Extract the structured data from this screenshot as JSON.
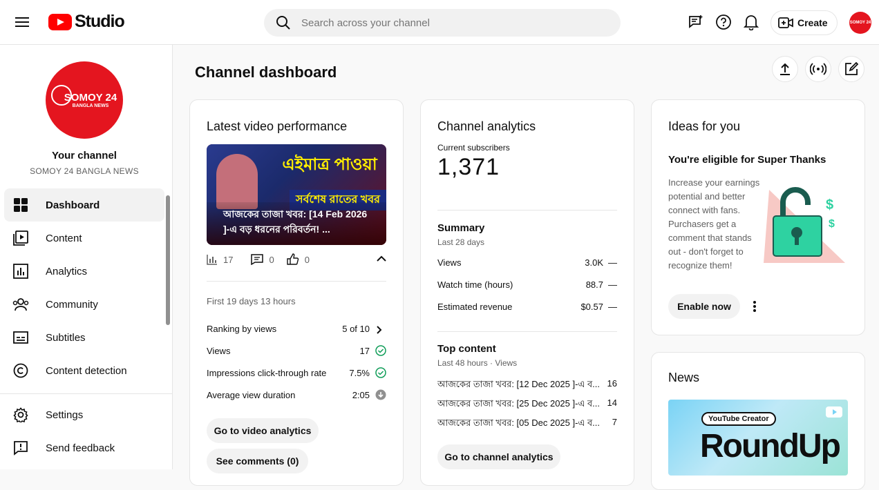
{
  "header": {
    "logo_text": "Studio",
    "search_placeholder": "Search across your channel",
    "create_label": "Create",
    "avatar_text": "SOMOY 24"
  },
  "sidebar": {
    "your_channel": "Your channel",
    "channel_name": "SOMOY 24 BANGLA NEWS",
    "avatar_line1": "SOMOY 24",
    "avatar_line2": "BANGLA NEWS",
    "items": [
      {
        "label": "Dashboard",
        "icon": "dashboard-icon",
        "active": true
      },
      {
        "label": "Content",
        "icon": "content-icon"
      },
      {
        "label": "Analytics",
        "icon": "analytics-icon"
      },
      {
        "label": "Community",
        "icon": "community-icon"
      },
      {
        "label": "Subtitles",
        "icon": "subtitles-icon"
      },
      {
        "label": "Content detection",
        "icon": "copyright-icon"
      }
    ],
    "bottom_items": [
      {
        "label": "Settings",
        "icon": "gear-icon"
      },
      {
        "label": "Send feedback",
        "icon": "feedback-icon"
      }
    ]
  },
  "main": {
    "title": "Channel dashboard"
  },
  "latest_video": {
    "title": "Latest video performance",
    "thumb_banner": "এইমাত্র পাওয়া",
    "thumb_banner2": "সর্বশেষ রাতের খবর",
    "caption": "আজকের তাজা খবর: [14 Feb 2026 ]-এ বড় ধরনের পরিবর্তন! ...",
    "views_count": "17",
    "comments_count": "0",
    "likes_count": "0",
    "period": "First 19 days 13 hours",
    "rows": [
      {
        "label": "Ranking by views",
        "value": "5 of 10"
      },
      {
        "label": "Views",
        "value": "17"
      },
      {
        "label": "Impressions click-through rate",
        "value": "7.5%"
      },
      {
        "label": "Average view duration",
        "value": "2:05"
      }
    ],
    "btn_analytics": "Go to video analytics",
    "btn_comments": "See comments (0)"
  },
  "channel_analytics": {
    "title": "Channel analytics",
    "subs_label": "Current subscribers",
    "subs_value": "1,371",
    "summary_title": "Summary",
    "summary_period": "Last 28 days",
    "summary_rows": [
      {
        "label": "Views",
        "value": "3.0K",
        "delta": "—"
      },
      {
        "label": "Watch time (hours)",
        "value": "88.7",
        "delta": "—"
      },
      {
        "label": "Estimated revenue",
        "value": "$0.57",
        "delta": "—"
      }
    ],
    "top_title": "Top content",
    "top_period": "Last 48 hours · Views",
    "top_rows": [
      {
        "label": "আজকের তাজা খবর: [12 Dec 2025 ]-এ ব...",
        "value": "16"
      },
      {
        "label": "আজকের তাজা খবর: [25 Dec 2025 ]-এ ব...",
        "value": "14"
      },
      {
        "label": "আজকের তাজা খবর: [05 Dec 2025 ]-এ ব...",
        "value": "7"
      }
    ],
    "btn": "Go to channel analytics"
  },
  "ideas": {
    "title": "Ideas for you",
    "heading": "You're eligible for Super Thanks",
    "body": "Increase your earnings potential and better connect with fans. Purchasers get a comment that stands out - don't forget to recognize them!",
    "btn": "Enable now"
  },
  "news": {
    "title": "News",
    "badge": "YouTube Creator",
    "banner": "RoundUp"
  },
  "colors": {
    "brand_red": "#ff0000",
    "channel_red": "#e4151f",
    "check_green": "#0f9d58",
    "neutral_grey": "#909090"
  }
}
